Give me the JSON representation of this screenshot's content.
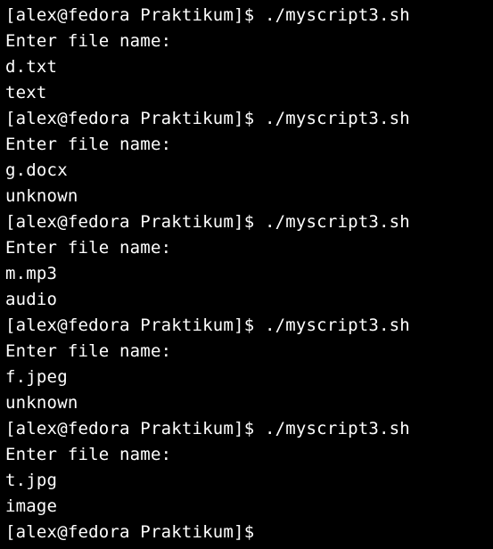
{
  "terminal": {
    "prompt": "[alex@fedora Praktikum]$",
    "runs": [
      {
        "command": "./myscript3.sh",
        "prompt_message": "Enter file name:",
        "input": "d.txt",
        "output": "text"
      },
      {
        "command": "./myscript3.sh",
        "prompt_message": "Enter file name:",
        "input": "g.docx",
        "output": "unknown"
      },
      {
        "command": "./myscript3.sh",
        "prompt_message": "Enter file name:",
        "input": "m.mp3",
        "output": "audio"
      },
      {
        "command": "./myscript3.sh",
        "prompt_message": "Enter file name:",
        "input": "f.jpeg",
        "output": "unknown"
      },
      {
        "command": "./myscript3.sh",
        "prompt_message": "Enter file name:",
        "input": "t.jpg",
        "output": "image"
      }
    ],
    "final_prompt": "[alex@fedora Praktikum]$"
  }
}
